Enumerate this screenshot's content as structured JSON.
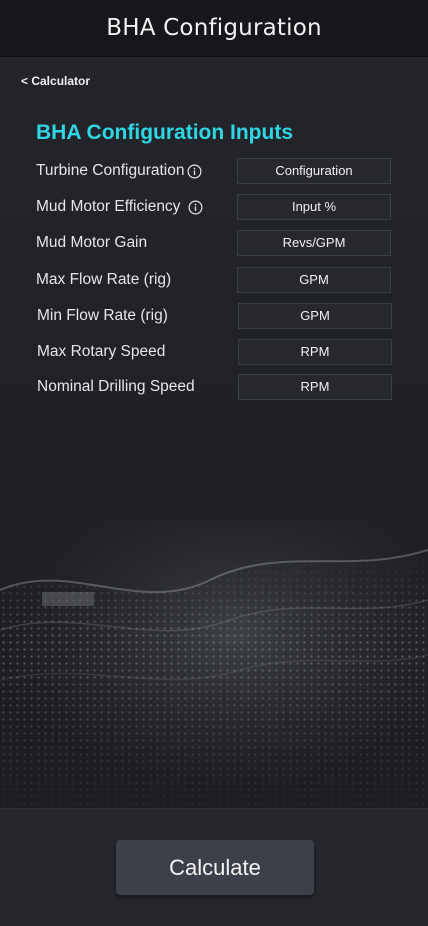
{
  "header": {
    "title": "BHA Configuration"
  },
  "nav": {
    "back_label": "< Calculator"
  },
  "section": {
    "title": "BHA Configuration Inputs"
  },
  "inputs": [
    {
      "label": "Turbine Configuration",
      "placeholder": "Configuration",
      "has_info": true
    },
    {
      "label": "Mud Motor Efficiency",
      "placeholder": "Input %",
      "has_info": true
    },
    {
      "label": "Mud Motor Gain",
      "placeholder": "Revs/GPM",
      "has_info": false
    },
    {
      "label": "Max Flow Rate (rig)",
      "placeholder": "GPM",
      "has_info": false
    },
    {
      "label": "Min Flow Rate (rig)",
      "placeholder": "GPM",
      "has_info": false
    },
    {
      "label": "Max Rotary Speed",
      "placeholder": "RPM",
      "has_info": false
    },
    {
      "label": "Nominal Drilling Speed",
      "placeholder": "RPM",
      "has_info": false
    }
  ],
  "footer": {
    "calculate_label": "Calculate"
  },
  "icons": {
    "info": "info-icon"
  },
  "colors": {
    "accent": "#2fd6e6",
    "background": "#1f2126",
    "header": "#16171a",
    "field": "#26282e",
    "button": "#3d4049"
  }
}
